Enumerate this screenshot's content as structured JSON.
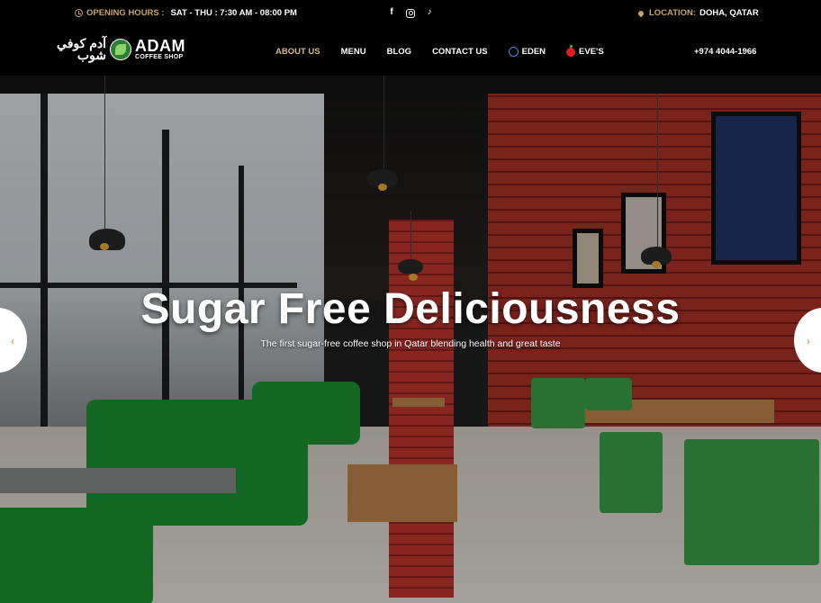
{
  "topbar": {
    "hours_label": "OPENING HOURS :",
    "hours_value": "SAT - THU : 7:30 AM - 08:00 PM",
    "social": [
      "facebook-icon",
      "instagram-icon",
      "tiktok-icon"
    ],
    "location_label": "LOCATION:",
    "location_value": "DOHA, QATAR"
  },
  "brand": {
    "arabic": "آدم كوفي شوب",
    "name": "ADAM",
    "tagline": "COFFEE SHOP"
  },
  "nav": {
    "items": [
      {
        "label": "ABOUT US",
        "active": true
      },
      {
        "label": "MENU"
      },
      {
        "label": "BLOG"
      },
      {
        "label": "CONTACT US"
      },
      {
        "label": "EDEN",
        "icon": "globe-icon"
      },
      {
        "label": "EVE'S",
        "icon": "apple-icon"
      }
    ],
    "phone": "+974 4044-1966"
  },
  "hero": {
    "title": "Sugar Free Deliciousness",
    "subtitle": "The first sugar-free coffee shop in Qatar blending health and great taste",
    "prev_icon": "chevron-left-icon",
    "next_icon": "chevron-right-icon"
  },
  "colors": {
    "accent": "#c9a46b",
    "active_nav": "#d8b98a",
    "background": "#000000"
  }
}
